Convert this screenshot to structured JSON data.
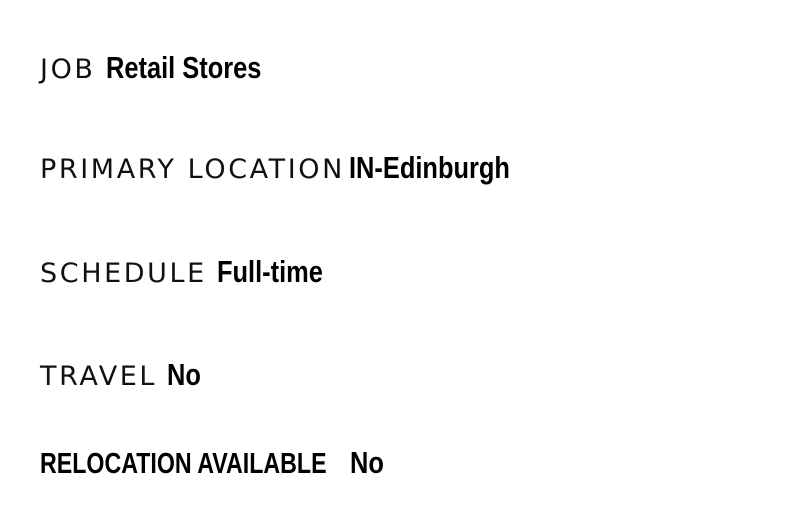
{
  "details": [
    {
      "label": "JOB",
      "value": "Retail Stores"
    },
    {
      "label": "PRIMARY LOCATION",
      "value": "IN-Edinburgh"
    },
    {
      "label": "SCHEDULE",
      "value": "Full-time"
    },
    {
      "label": "TRAVEL",
      "value": "No"
    },
    {
      "label": "RELOCATION AVAILABLE",
      "value": "No"
    }
  ]
}
